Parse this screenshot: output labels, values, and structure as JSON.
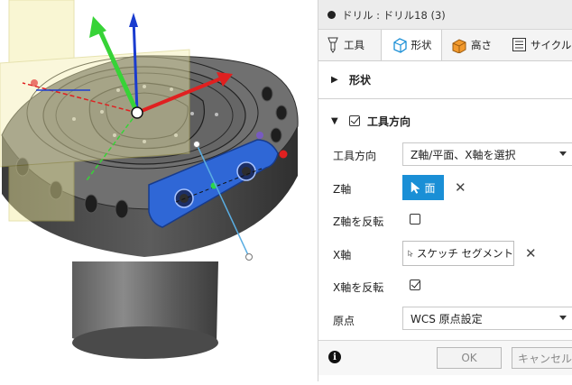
{
  "panel": {
    "title": "ドリル : ドリル18 (3)",
    "tabs": [
      {
        "label": "工具",
        "icon": "tool-icon"
      },
      {
        "label": "形状",
        "icon": "geometry-icon"
      },
      {
        "label": "高さ",
        "icon": "heights-icon"
      },
      {
        "label": "サイクル",
        "icon": "cycle-icon"
      }
    ],
    "active_tab": "形状",
    "section_shape": {
      "label": "形状",
      "expanded": false
    },
    "section_orientation": {
      "label": "工具方向",
      "expanded": true,
      "checked": true
    },
    "fields": {
      "orientation_label": "工具方向",
      "orientation_value": "Z軸/平面、X軸を選択",
      "z_axis_label": "Z軸",
      "z_axis_selection": "面",
      "flip_z_label": "Z軸を反転",
      "flip_z_checked": false,
      "x_axis_label": "X軸",
      "x_axis_selection": "スケッチ セグメント",
      "flip_x_label": "X軸を反転",
      "flip_x_checked": true,
      "origin_label": "原点",
      "origin_value": "WCS 原点設定"
    },
    "footer": {
      "ok": "OK",
      "cancel": "キャンセル",
      "info_symbol": "i"
    }
  },
  "colors": {
    "accent": "#1a8fd6",
    "selection_face": "#2f67d6",
    "axis_z": "#1a3ccf",
    "axis_y": "#37d337",
    "axis_x": "#e02020"
  }
}
